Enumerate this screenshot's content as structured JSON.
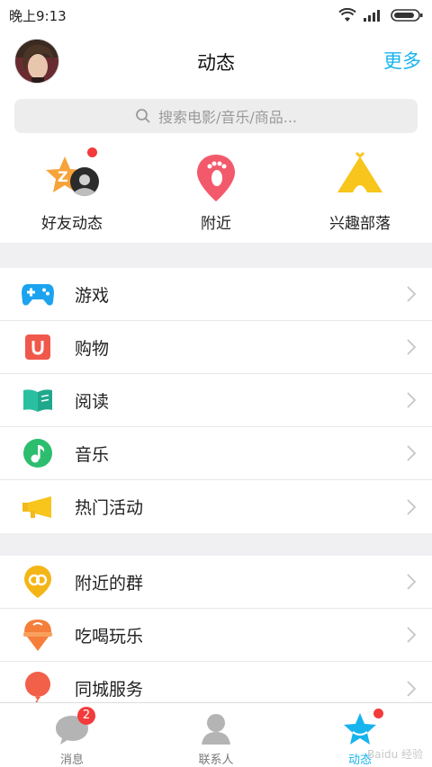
{
  "status": {
    "time": "晚上9:13"
  },
  "header": {
    "title": "动态",
    "more": "更多"
  },
  "search": {
    "placeholder": "搜索电影/音乐/商品..."
  },
  "quick": [
    {
      "label": "好友动态",
      "icon": "friends-star-icon"
    },
    {
      "label": "附近",
      "icon": "nearby-footprint-icon"
    },
    {
      "label": "兴趣部落",
      "icon": "tribe-tent-icon"
    }
  ],
  "section1": [
    {
      "label": "游戏",
      "icon": "gamepad-icon"
    },
    {
      "label": "购物",
      "icon": "shopping-bag-icon"
    },
    {
      "label": "阅读",
      "icon": "book-icon"
    },
    {
      "label": "音乐",
      "icon": "music-note-icon"
    },
    {
      "label": "热门活动",
      "icon": "megaphone-icon"
    }
  ],
  "section2": [
    {
      "label": "附近的群",
      "icon": "nearby-group-icon"
    },
    {
      "label": "吃喝玩乐",
      "icon": "ice-cream-icon"
    },
    {
      "label": "同城服务",
      "icon": "balloon-icon"
    }
  ],
  "tabs": [
    {
      "label": "消息",
      "badge": "2",
      "icon": "chat-bubble-icon"
    },
    {
      "label": "联系人",
      "icon": "contact-person-icon"
    },
    {
      "label": "动态",
      "icon": "star-dynamic-icon"
    }
  ],
  "watermark": "Baidu 经验",
  "colors": {
    "accent": "#18b4ed",
    "badge": "#f33b3b"
  }
}
